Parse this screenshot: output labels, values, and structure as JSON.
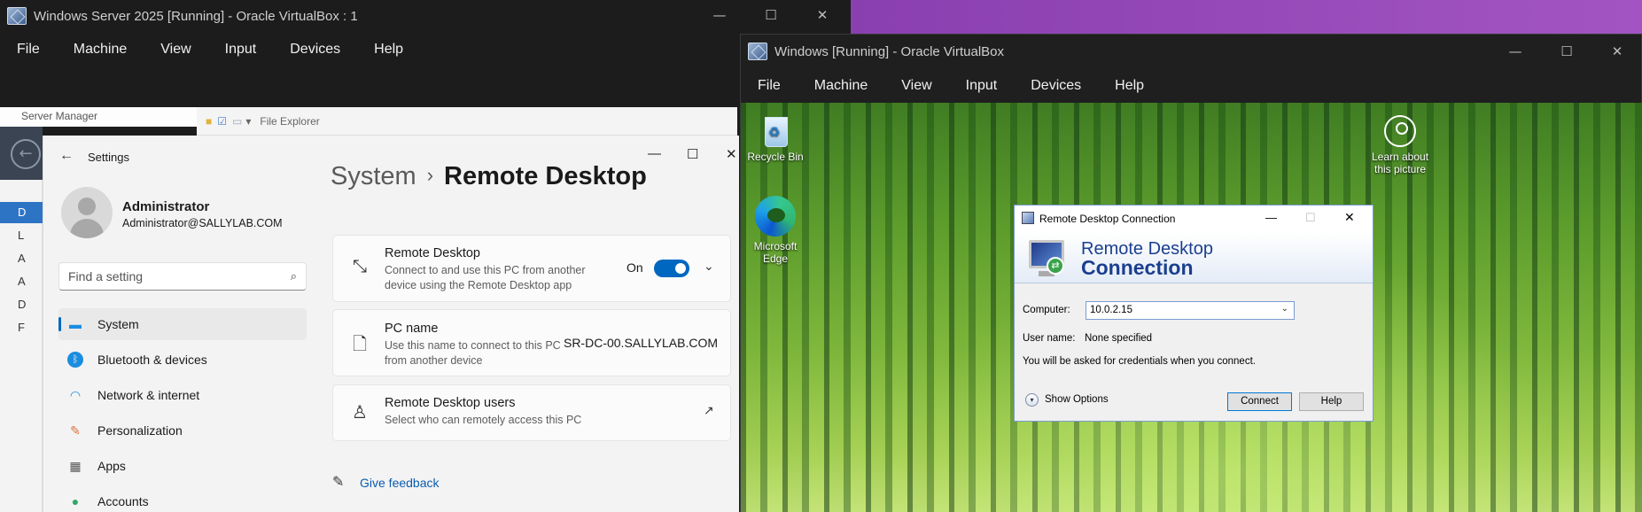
{
  "vm1": {
    "title": "Windows Server 2025 [Running] - Oracle VirtualBox : 1",
    "menu": [
      "File",
      "Machine",
      "View",
      "Input",
      "Devices",
      "Help"
    ],
    "server_manager_title": "Server Manager",
    "file_explorer_title": "File Explorer",
    "server_nav_letters": [
      "D",
      "L",
      "A",
      "A",
      "D",
      "F"
    ]
  },
  "settings": {
    "window_title": "Settings",
    "user": {
      "name": "Administrator",
      "email": "Administrator@SALLYLAB.COM"
    },
    "search_placeholder": "Find a setting",
    "nav": [
      {
        "label": "System",
        "icon": "system-icon",
        "active": true
      },
      {
        "label": "Bluetooth & devices",
        "icon": "bluetooth-icon"
      },
      {
        "label": "Network & internet",
        "icon": "wifi-icon"
      },
      {
        "label": "Personalization",
        "icon": "brush-icon"
      },
      {
        "label": "Apps",
        "icon": "apps-icon"
      },
      {
        "label": "Accounts",
        "icon": "accounts-icon"
      }
    ],
    "breadcrumb": {
      "parent": "System",
      "separator": "›",
      "current": "Remote Desktop"
    },
    "cards": {
      "remote_desktop": {
        "title": "Remote Desktop",
        "subtitle1": "Connect to and use this PC from another",
        "subtitle2": "device using the Remote Desktop app",
        "state": "On"
      },
      "pc_name": {
        "title": "PC name",
        "subtitle1": "Use this name to connect to this PC",
        "subtitle2": "from another device",
        "value": "SR-DC-00.SALLYLAB.COM"
      },
      "users": {
        "title": "Remote Desktop users",
        "subtitle1": "Select who can remotely access this PC"
      }
    },
    "feedback": "Give feedback"
  },
  "vm2": {
    "title": "Windows [Running] - Oracle VirtualBox",
    "menu": [
      "File",
      "Machine",
      "View",
      "Input",
      "Devices",
      "Help"
    ],
    "desktop_icons": {
      "recycle_bin": "Recycle Bin",
      "edge_line1": "Microsoft",
      "edge_line2": "Edge",
      "learn_line1": "Learn about",
      "learn_line2": "this picture"
    }
  },
  "rdc": {
    "title": "Remote Desktop Connection",
    "banner_line1": "Remote Desktop",
    "banner_line2": "Connection",
    "computer_label": "Computer:",
    "computer_value": "10.0.2.15",
    "username_label": "User name:",
    "username_value": "None specified",
    "note": "You will be asked for credentials when you connect.",
    "show_options": "Show Options",
    "connect": "Connect",
    "help": "Help"
  },
  "colors": {
    "accent": "#0067c0",
    "purple": "#9a4cbd",
    "vbox_dark": "#1c1c1c"
  }
}
